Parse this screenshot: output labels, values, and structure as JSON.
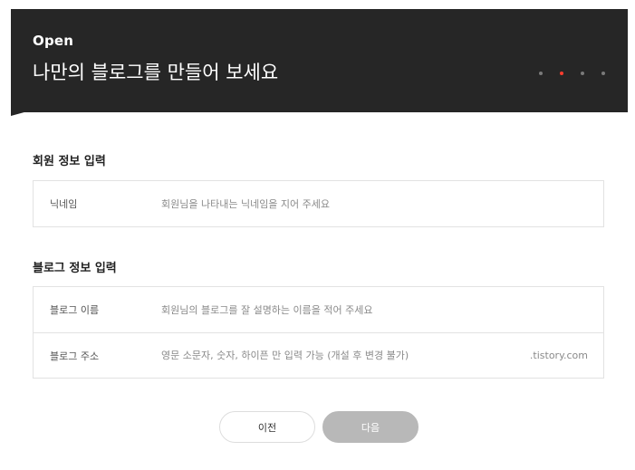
{
  "header": {
    "eyebrow": "Open",
    "title": "나만의 블로그를 만들어 보세요",
    "steps": {
      "total": 4,
      "current": 2
    },
    "colors": {
      "background": "#262626",
      "active_step": "#ff3d2e",
      "inactive_step": "#7a7a7a"
    }
  },
  "member_section": {
    "title": "회원 정보 입력",
    "fields": [
      {
        "label": "닉네임",
        "value": "",
        "placeholder": "회원님을 나타내는 닉네임을 지어 주세요"
      }
    ]
  },
  "blog_section": {
    "title": "블로그 정보 입력",
    "fields": [
      {
        "label": "블로그 이름",
        "value": "",
        "placeholder": "회원님의 블로그를 잘 설명하는 이름을 적어 주세요"
      },
      {
        "label": "블로그 주소",
        "value": "",
        "placeholder": "영문 소문자, 숫자, 하이픈 만 입력 가능 (개설 후 변경 불가)",
        "suffix": ".tistory.com"
      }
    ]
  },
  "actions": {
    "prev_label": "이전",
    "next_label": "다음",
    "colors": {
      "next_disabled": "#b8b8b8"
    }
  }
}
